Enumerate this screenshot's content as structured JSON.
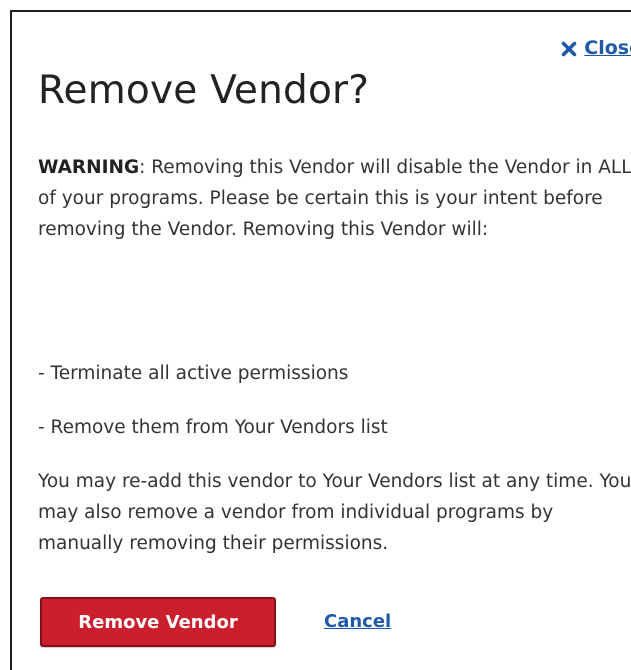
{
  "dialog": {
    "close_label": "Close",
    "title": "Remove Vendor?",
    "warning_label": "WARNING",
    "warning_text": ": Removing this Vendor will disable the Vendor in ALL of your programs. Please be certain this is your intent before removing the Vendor. Removing this Vendor will:",
    "bullets": [
      "- Terminate all active permissions",
      "- Remove them from Your Vendors list"
    ],
    "readd_text": "You may re-add this vendor to Your Vendors list at any time. You may also remove a vendor from individual programs by manually removing their permissions.",
    "remove_button_label": "Remove Vendor",
    "cancel_label": "Cancel",
    "close_icon": "close-icon"
  },
  "colors": {
    "link": "#1f5aa8",
    "danger": "#cc1f2e",
    "danger_border": "#7f1018",
    "text": "#333333"
  }
}
